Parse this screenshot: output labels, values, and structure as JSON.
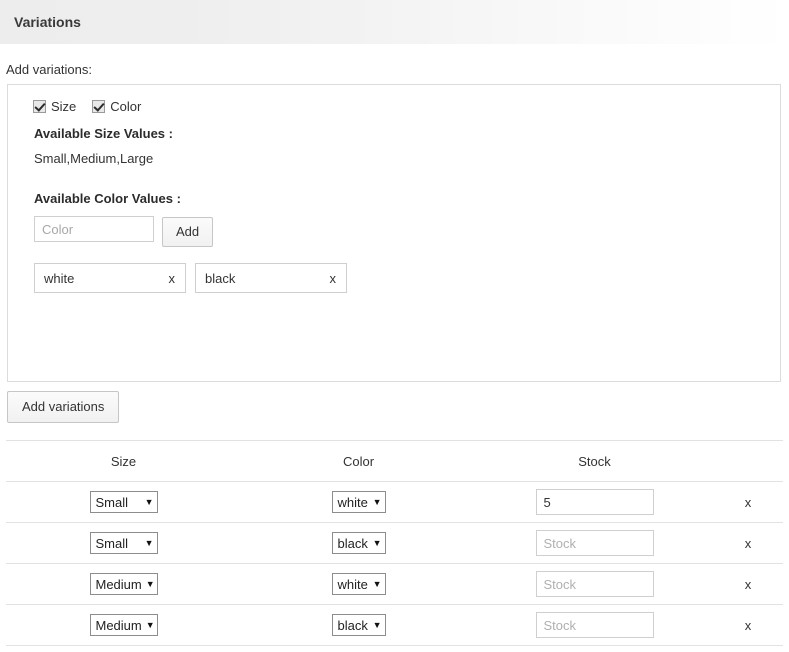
{
  "panel": {
    "title": "Variations"
  },
  "section": {
    "add_variations_label": "Add variations:"
  },
  "variation_types": [
    {
      "label": "Size",
      "checked": true
    },
    {
      "label": "Color",
      "checked": true
    }
  ],
  "size_values": {
    "heading": "Available Size Values :",
    "values": "Small,Medium,Large"
  },
  "color_values": {
    "heading": "Available Color Values :",
    "input_placeholder": "Color",
    "input_value": "",
    "add_button": "Add",
    "tags": [
      {
        "label": "white",
        "remove": "x"
      },
      {
        "label": "black",
        "remove": "x"
      }
    ]
  },
  "actions": {
    "add_variations_button": "Add variations"
  },
  "table": {
    "headers": [
      "Size",
      "Color",
      "Stock",
      ""
    ],
    "stock_placeholder": "Stock",
    "remove_label": "x",
    "caret_glyph": "▼",
    "rows": [
      {
        "size": "Small",
        "color": "white",
        "stock": "5"
      },
      {
        "size": "Small",
        "color": "black",
        "stock": ""
      },
      {
        "size": "Medium",
        "color": "white",
        "stock": ""
      },
      {
        "size": "Medium",
        "color": "black",
        "stock": ""
      }
    ]
  },
  "colors": {
    "header_gradient_start": "#ededed",
    "header_gradient_end": "#ffffff",
    "border": "#dcdcdc",
    "table_border": "#e2e2e2",
    "text": "#333333"
  }
}
